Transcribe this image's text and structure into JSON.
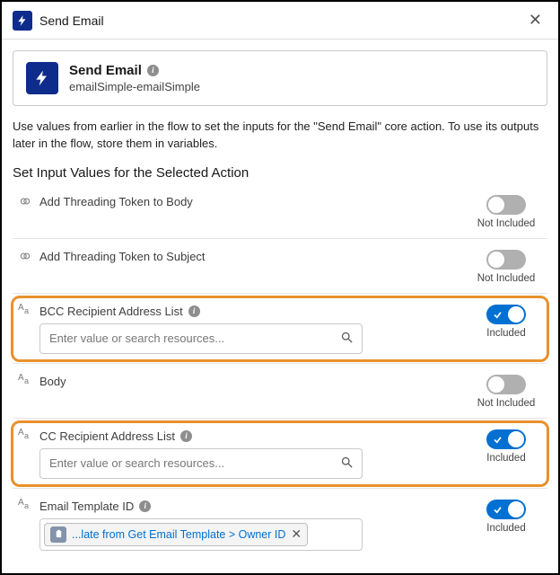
{
  "dialog": {
    "title": "Send Email"
  },
  "card": {
    "title": "Send Email",
    "sub": "emailSimple-emailSimple"
  },
  "desc": "Use values from earlier in the flow to set the inputs for the \"Send Email\" core action. To use its outputs later in the flow, store them in variables.",
  "section": "Set Input Values for the Selected Action",
  "labels": {
    "not_included": "Not Included",
    "included": "Included"
  },
  "fields": [
    {
      "icon": "chain",
      "label": "Add Threading Token to Body",
      "info": false,
      "input": "none",
      "included": false
    },
    {
      "icon": "chain",
      "label": "Add Threading Token to Subject",
      "info": false,
      "input": "none",
      "included": false
    },
    {
      "icon": "aa",
      "label": "BCC Recipient Address List",
      "info": true,
      "input": "search",
      "placeholder": "Enter value or search resources...",
      "included": true,
      "highlight": true
    },
    {
      "icon": "aa",
      "label": "Body",
      "info": false,
      "input": "none",
      "included": false
    },
    {
      "icon": "aa",
      "label": "CC Recipient Address List",
      "info": true,
      "input": "search",
      "placeholder": "Enter value or search resources...",
      "included": true,
      "highlight": true
    },
    {
      "icon": "aa",
      "label": "Email Template ID",
      "info": true,
      "input": "pill",
      "pill_text": "...late from Get Email Template > Owner ID",
      "included": true
    }
  ]
}
